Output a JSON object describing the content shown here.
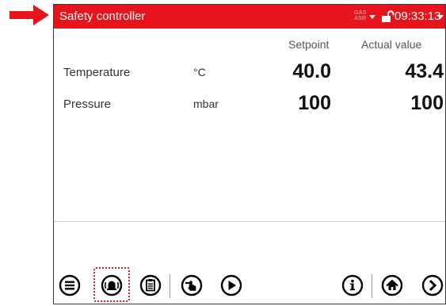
{
  "titlebar": {
    "title": "Safety controller",
    "gas_asr_line1": "GAS",
    "gas_asr_line2": "ASR",
    "time": "09:33:13",
    "color": "#e8141c"
  },
  "table": {
    "header_setpoint": "Setpoint",
    "header_actual": "Actual value",
    "rows": [
      {
        "label": "Temperature",
        "unit": "°C",
        "setpoint": "40.0",
        "actual": "43.4"
      },
      {
        "label": "Pressure",
        "unit": "mbar",
        "setpoint": "100",
        "actual": "100"
      }
    ]
  },
  "toolbar": {
    "buttons": [
      "menu-list-icon",
      "alarm-bell-icon",
      "clipboard-icon",
      "manual-control-icon",
      "play-icon",
      "info-icon",
      "home-icon",
      "forward-arrow-icon"
    ]
  },
  "annotation": {
    "arrow_color": "#e8141c"
  }
}
